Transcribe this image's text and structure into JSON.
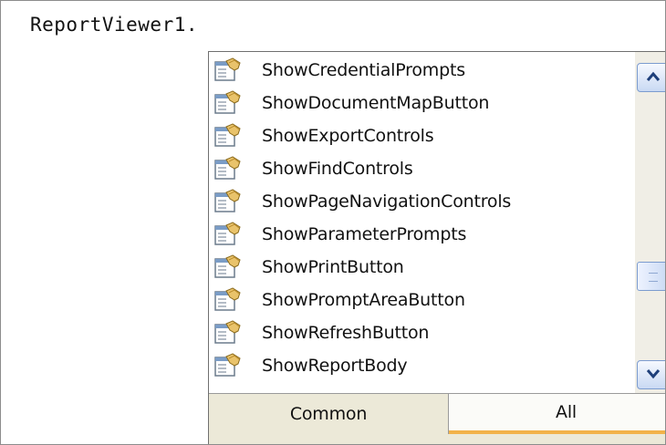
{
  "code_line": "ReportViewer1.",
  "members": [
    {
      "label": "ShowCredentialPrompts",
      "icon": "property-icon"
    },
    {
      "label": "ShowDocumentMapButton",
      "icon": "property-icon"
    },
    {
      "label": "ShowExportControls",
      "icon": "property-icon"
    },
    {
      "label": "ShowFindControls",
      "icon": "property-icon"
    },
    {
      "label": "ShowPageNavigationControls",
      "icon": "property-icon"
    },
    {
      "label": "ShowParameterPrompts",
      "icon": "property-icon"
    },
    {
      "label": "ShowPrintButton",
      "icon": "property-icon"
    },
    {
      "label": "ShowPromptAreaButton",
      "icon": "property-icon"
    },
    {
      "label": "ShowRefreshButton",
      "icon": "property-icon"
    },
    {
      "label": "ShowReportBody",
      "icon": "property-icon"
    }
  ],
  "tabs": {
    "common": "Common",
    "all": "All",
    "selected": "All"
  },
  "scrollbar": {
    "position": 0.62
  }
}
